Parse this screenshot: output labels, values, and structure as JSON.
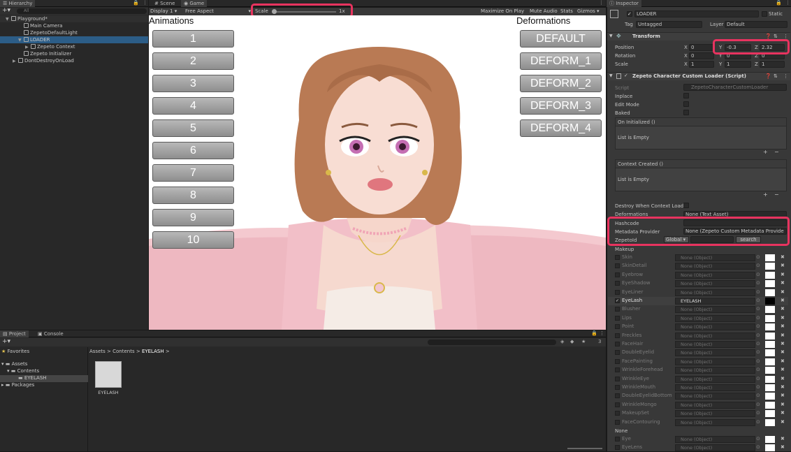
{
  "hierarchy": {
    "tab": "Hierarchy",
    "search_placeholder": "All",
    "items": [
      {
        "label": "Playground*",
        "indent": 0
      },
      {
        "label": "Main Camera",
        "indent": 1
      },
      {
        "label": "ZepetoDefaultLight",
        "indent": 1
      },
      {
        "label": "LOADER",
        "indent": 1
      },
      {
        "label": "Zepeto Context",
        "indent": 2
      },
      {
        "label": "Zepeto Initializer",
        "indent": 1
      },
      {
        "label": "DontDestroyOnLoad",
        "indent": 0
      }
    ]
  },
  "scene_tabs": {
    "scene": "Scene",
    "game": "Game"
  },
  "game_toolbar": {
    "display": "Display 1",
    "aspect": "Free Aspect",
    "scale_label": "Scale",
    "scale_value": "1x",
    "maximize": "Maximize On Play",
    "mute": "Mute Audio",
    "stats": "Stats",
    "gizmos": "Gizmos"
  },
  "game": {
    "animations_title": "Animations",
    "deformations_title": "Deformations",
    "animation_buttons": [
      "1",
      "2",
      "3",
      "4",
      "5",
      "6",
      "7",
      "8",
      "9",
      "10"
    ],
    "deformation_buttons": [
      "DEFAULT",
      "DEFORM_1",
      "DEFORM_2",
      "DEFORM_3",
      "DEFORM_4"
    ]
  },
  "inspector": {
    "tab": "Inspector",
    "object_name": "LOADER",
    "static_label": "Static",
    "tag_label": "Tag",
    "tag_value": "Untagged",
    "layer_label": "Layer",
    "layer_value": "Default",
    "transform": {
      "title": "Transform",
      "position_label": "Position",
      "rotation_label": "Rotation",
      "scale_label": "Scale",
      "axis_x": "X",
      "axis_y": "Y",
      "axis_z": "Z",
      "position": [
        "0",
        "-0.3",
        "2.32"
      ],
      "rotation": [
        "0",
        "0",
        "0"
      ],
      "scale": [
        "1",
        "1",
        "1"
      ]
    },
    "script_component": {
      "title": "Zepeto Character Custom Loader (Script)",
      "script_label": "Script",
      "script_value": "ZepetoCharacterCustomLoader",
      "inplace": "Inplace",
      "edit_mode": "Edit Mode",
      "baked": "Baked",
      "on_initialized": "On Initialized ()",
      "list_empty": "List is Empty",
      "context_created": "Context Created ()",
      "destroy_when": "Destroy When Context Load",
      "deformations_label": "Deformations",
      "deformations_value": "None (Text Asset)",
      "hashcode_label": "Hashcode",
      "metadata_label": "Metadata Provider",
      "metadata_value": "None (Zepeto Custom Metadata Provide",
      "zepetoid_label": "ZepetoId",
      "zepetoid_scope": "Global",
      "search_button": "search"
    },
    "makeup_title": "Makeup",
    "makeup": [
      {
        "name": "Skin",
        "value": "None (Object)"
      },
      {
        "name": "SkinDetail",
        "value": "None (Object)"
      },
      {
        "name": "Eyebrow",
        "value": "None (Object)"
      },
      {
        "name": "EyeShadow",
        "value": "None (Object)"
      },
      {
        "name": "EyeLiner",
        "value": "None (Object)"
      },
      {
        "name": "EyeLash",
        "value": "EYELASH"
      },
      {
        "name": "Blusher",
        "value": "None (Object)"
      },
      {
        "name": "Lips",
        "value": "None (Object)"
      },
      {
        "name": "Point",
        "value": "None (Object)"
      },
      {
        "name": "Freckles",
        "value": "None (Object)"
      },
      {
        "name": "FaceHair",
        "value": "None (Object)"
      },
      {
        "name": "DoubleEyelid",
        "value": "None (Object)"
      },
      {
        "name": "FacePainting",
        "value": "None (Object)"
      },
      {
        "name": "WrinkleForehead",
        "value": "None (Object)"
      },
      {
        "name": "WrinkleEye",
        "value": "None (Object)"
      },
      {
        "name": "WrinkleMouth",
        "value": "None (Object)"
      },
      {
        "name": "DoubleEyelidBottom",
        "value": "None (Object)"
      },
      {
        "name": "WrinkleMongo",
        "value": "None (Object)"
      },
      {
        "name": "MakeupSet",
        "value": "None (Object)"
      },
      {
        "name": "FaceContouring",
        "value": "None (Object)"
      }
    ],
    "none_title": "None",
    "none_items": [
      {
        "name": "Eye",
        "value": "None (Object)"
      },
      {
        "name": "EyeLens",
        "value": "None (Object)"
      }
    ]
  },
  "project": {
    "tab_project": "Project",
    "tab_console": "Console",
    "favorites": "Favorites",
    "assets": "Assets",
    "contents": "Contents",
    "eyelash_folder": "EYELASH",
    "packages": "Packages",
    "breadcrumb": [
      "Assets",
      "Contents",
      "EYELASH"
    ],
    "asset_name": "EYELASH",
    "count": "3"
  }
}
